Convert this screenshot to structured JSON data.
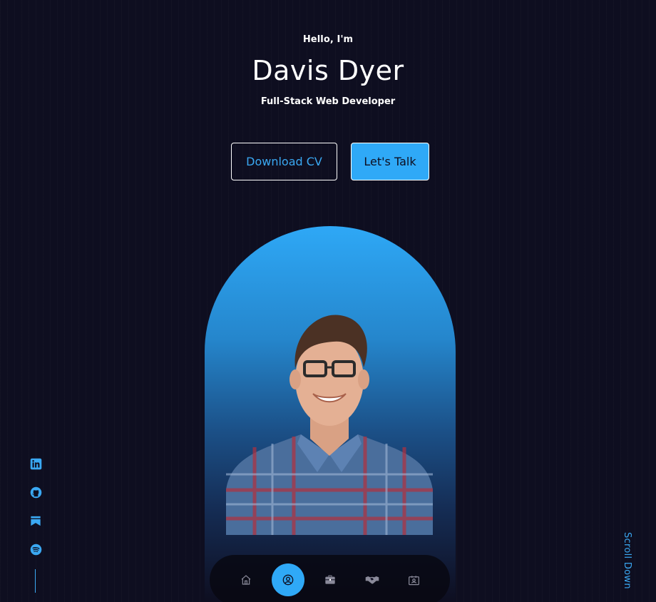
{
  "hero": {
    "greeting": "Hello, I'm",
    "name": "Davis Dyer",
    "role": "Full-Stack Web Developer"
  },
  "buttons": {
    "download_cv": "Download CV",
    "lets_talk": "Let's Talk"
  },
  "socials": [
    {
      "icon": "linkedin-icon"
    },
    {
      "icon": "github-icon"
    },
    {
      "icon": "bookmark-icon"
    },
    {
      "icon": "spotify-icon"
    }
  ],
  "scroll_down": "Scroll Down",
  "nav": [
    {
      "icon": "home-icon",
      "active": false
    },
    {
      "icon": "user-icon",
      "active": true
    },
    {
      "icon": "briefcase-icon",
      "active": false
    },
    {
      "icon": "handshake-icon",
      "active": false
    },
    {
      "icon": "contact-card-icon",
      "active": false
    }
  ],
  "colors": {
    "background": "#0e0e20",
    "accent": "#2fa9f7",
    "text": "#ffffff"
  }
}
